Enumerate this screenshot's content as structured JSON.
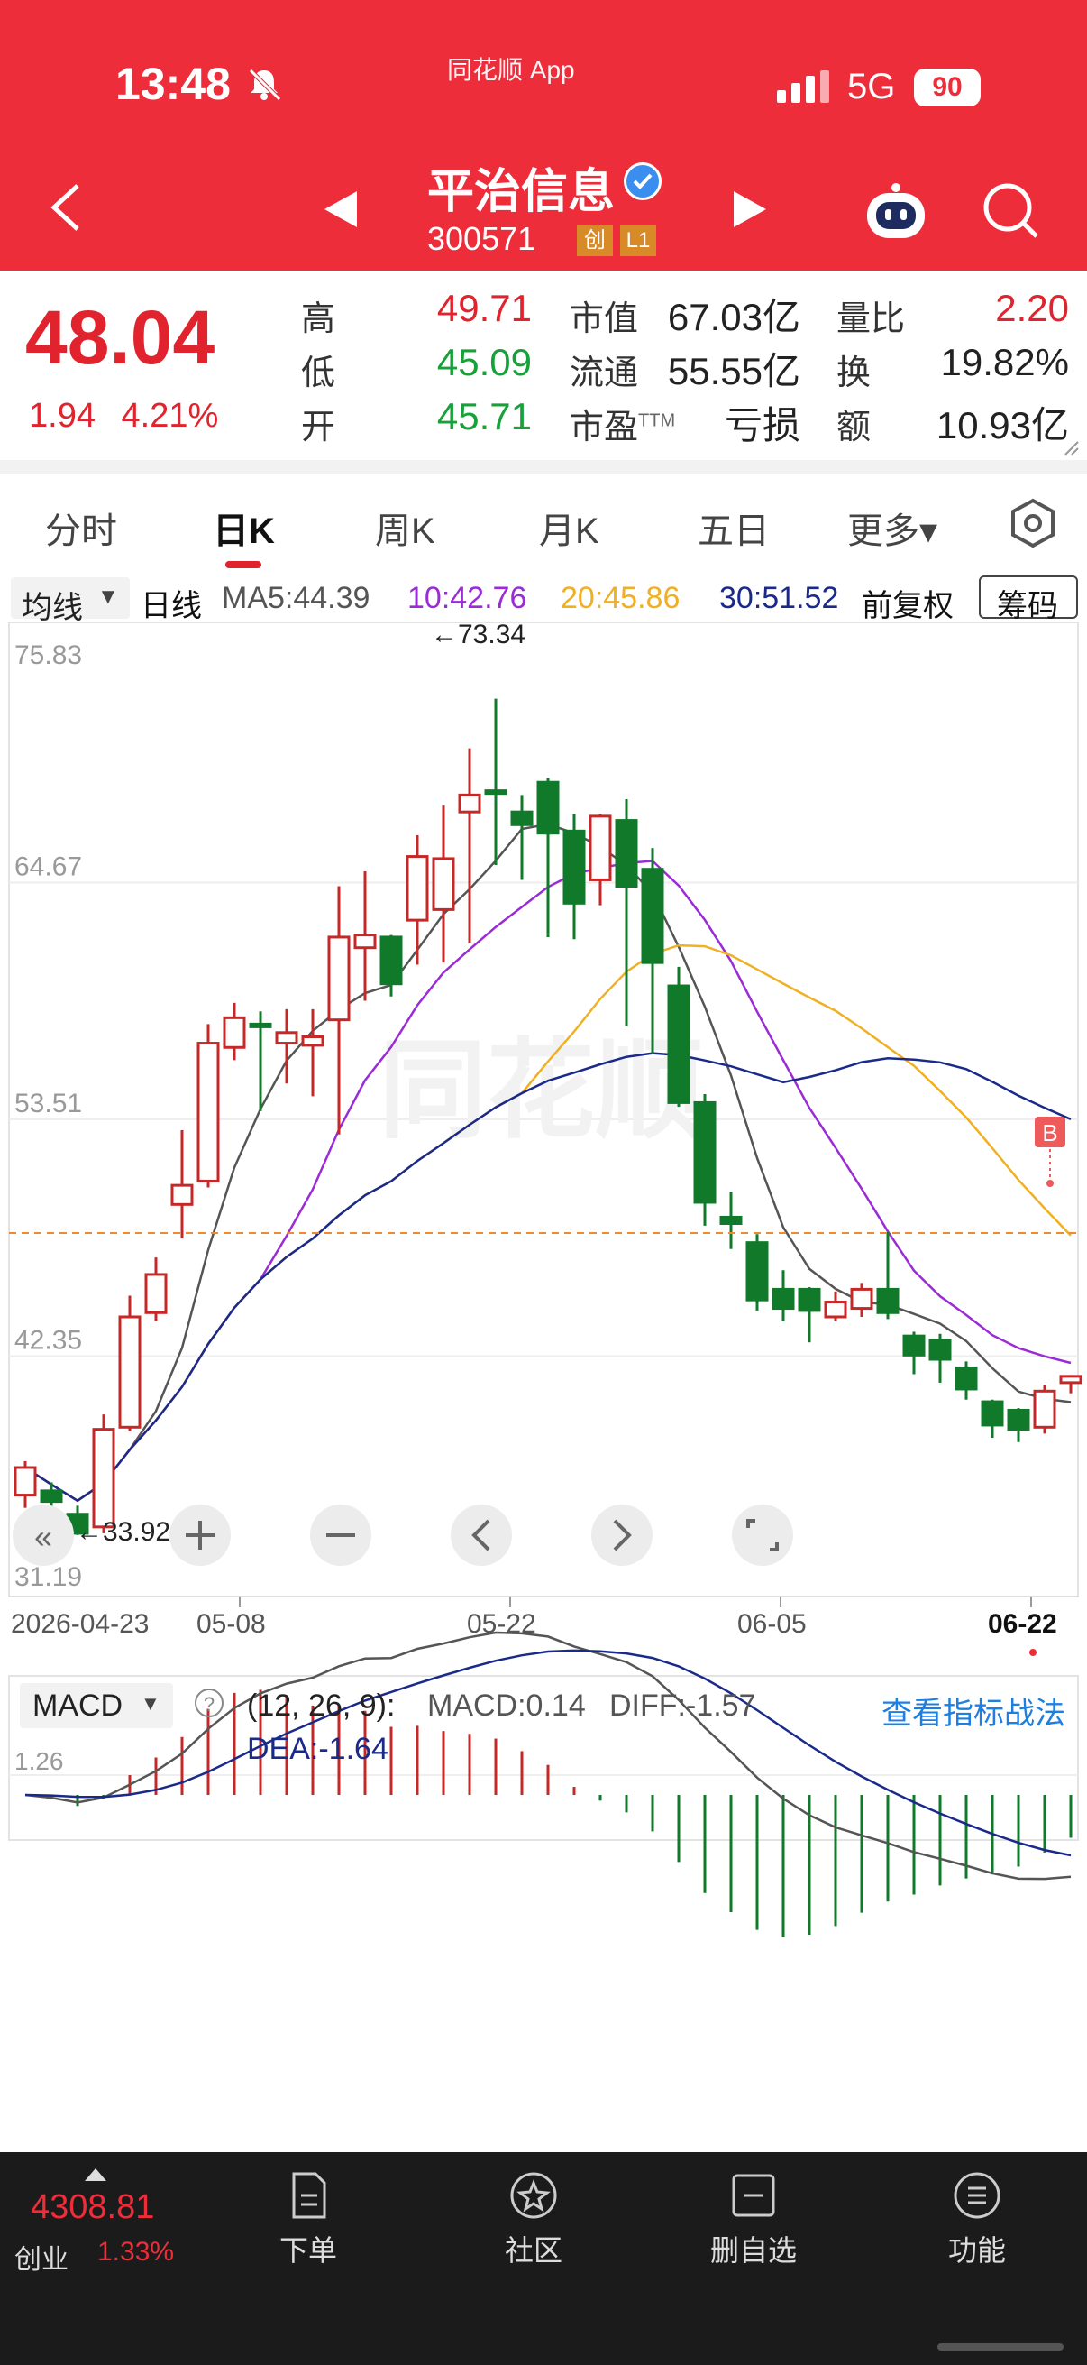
{
  "status_bar": {
    "time": "13:48",
    "app_label": "同花顺 App",
    "network": "5G",
    "battery": "90"
  },
  "header": {
    "stock_name": "平治信息",
    "stock_code": "300571",
    "tags": [
      "创",
      "L1"
    ]
  },
  "quote": {
    "price": "48.04",
    "change": "1.94",
    "change_pct": "4.21%",
    "fields": {
      "high_label": "高",
      "high": "49.71",
      "low_label": "低",
      "low": "45.09",
      "open_label": "开",
      "open": "45.71",
      "mcap_label": "市值",
      "mcap": "67.03亿",
      "float_label": "流通",
      "float": "55.55亿",
      "pe_label": "市盈",
      "pe_sup": "TTM",
      "pe": "亏损",
      "vr_label": "量比",
      "vr": "2.20",
      "turnover_label": "换",
      "turnover": "19.82%",
      "amount_label": "额",
      "amount": "10.93亿"
    }
  },
  "tabs": [
    "分时",
    "日K",
    "周K",
    "月K",
    "五日",
    "更多▾"
  ],
  "ma_bar": {
    "select_label": "均线",
    "period": "日线",
    "ma5": "MA5:44.39",
    "ma10": "10:42.76",
    "ma20": "20:45.86",
    "ma30": "30:51.52",
    "adjust": "前复权",
    "chips_button": "筹码"
  },
  "kline": {
    "y_labels": [
      "75.83",
      "64.67",
      "53.51",
      "42.35",
      "31.19"
    ],
    "max_marker": "←73.34",
    "min_marker": "←33.92",
    "x_labels": [
      "2026-04-23",
      "05-08",
      "05-22",
      "06-05",
      "06-22"
    ],
    "b_marker": "B",
    "watermark": "同花顺",
    "colors": {
      "up": "#c62828",
      "down": "#117a2a",
      "ma5": "#555555",
      "ma10": "#9b2bd6",
      "ma20": "#f0b024",
      "ma30": "#1a2a8a",
      "price_line": "#f08a30"
    }
  },
  "macd": {
    "select_label": "MACD",
    "params": "(12, 26, 9):",
    "macd": "MACD:0.14",
    "diff": "DIFF:-1.57",
    "dea": "DEA:-1.64",
    "link": "查看指标战法",
    "y_label": "1.26"
  },
  "bottom_nav": {
    "index_value": "4308.81",
    "index_name": "创业",
    "index_change": "1.33%",
    "items": [
      "下单",
      "社区",
      "删自选",
      "功能"
    ]
  }
}
